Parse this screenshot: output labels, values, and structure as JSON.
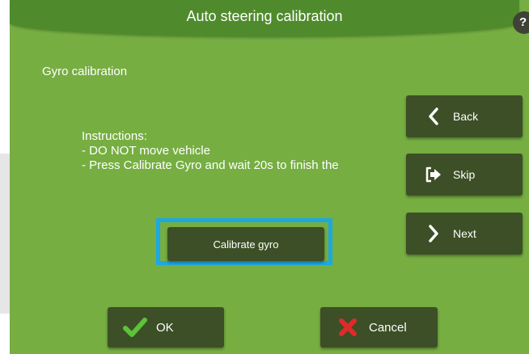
{
  "header": {
    "title": "Auto steering calibration",
    "help_label": "?"
  },
  "section": {
    "title": "Gyro calibration"
  },
  "instructions": {
    "heading": "Instructions:",
    "lines": [
      "- DO NOT move vehicle",
      "- Press Calibrate Gyro and wait 20s to finish the"
    ]
  },
  "side_buttons": {
    "back": {
      "label": "Back",
      "icon": "chevron-left-icon"
    },
    "skip": {
      "label": "Skip",
      "icon": "exit-arrow-icon"
    },
    "next": {
      "label": "Next",
      "icon": "chevron-right-icon"
    }
  },
  "main_button": {
    "label": "Calibrate gyro"
  },
  "bottom_buttons": {
    "ok": {
      "label": "OK",
      "icon": "checkmark-icon"
    },
    "cancel": {
      "label": "Cancel",
      "icon": "x-icon"
    }
  },
  "colors": {
    "background": "#76ae42",
    "title_bar": "#4f8b2c",
    "button": "#3d4f26",
    "focus": "#1ca8e2",
    "ok_icon": "#5cc33a",
    "cancel_icon": "#e02a2a"
  }
}
